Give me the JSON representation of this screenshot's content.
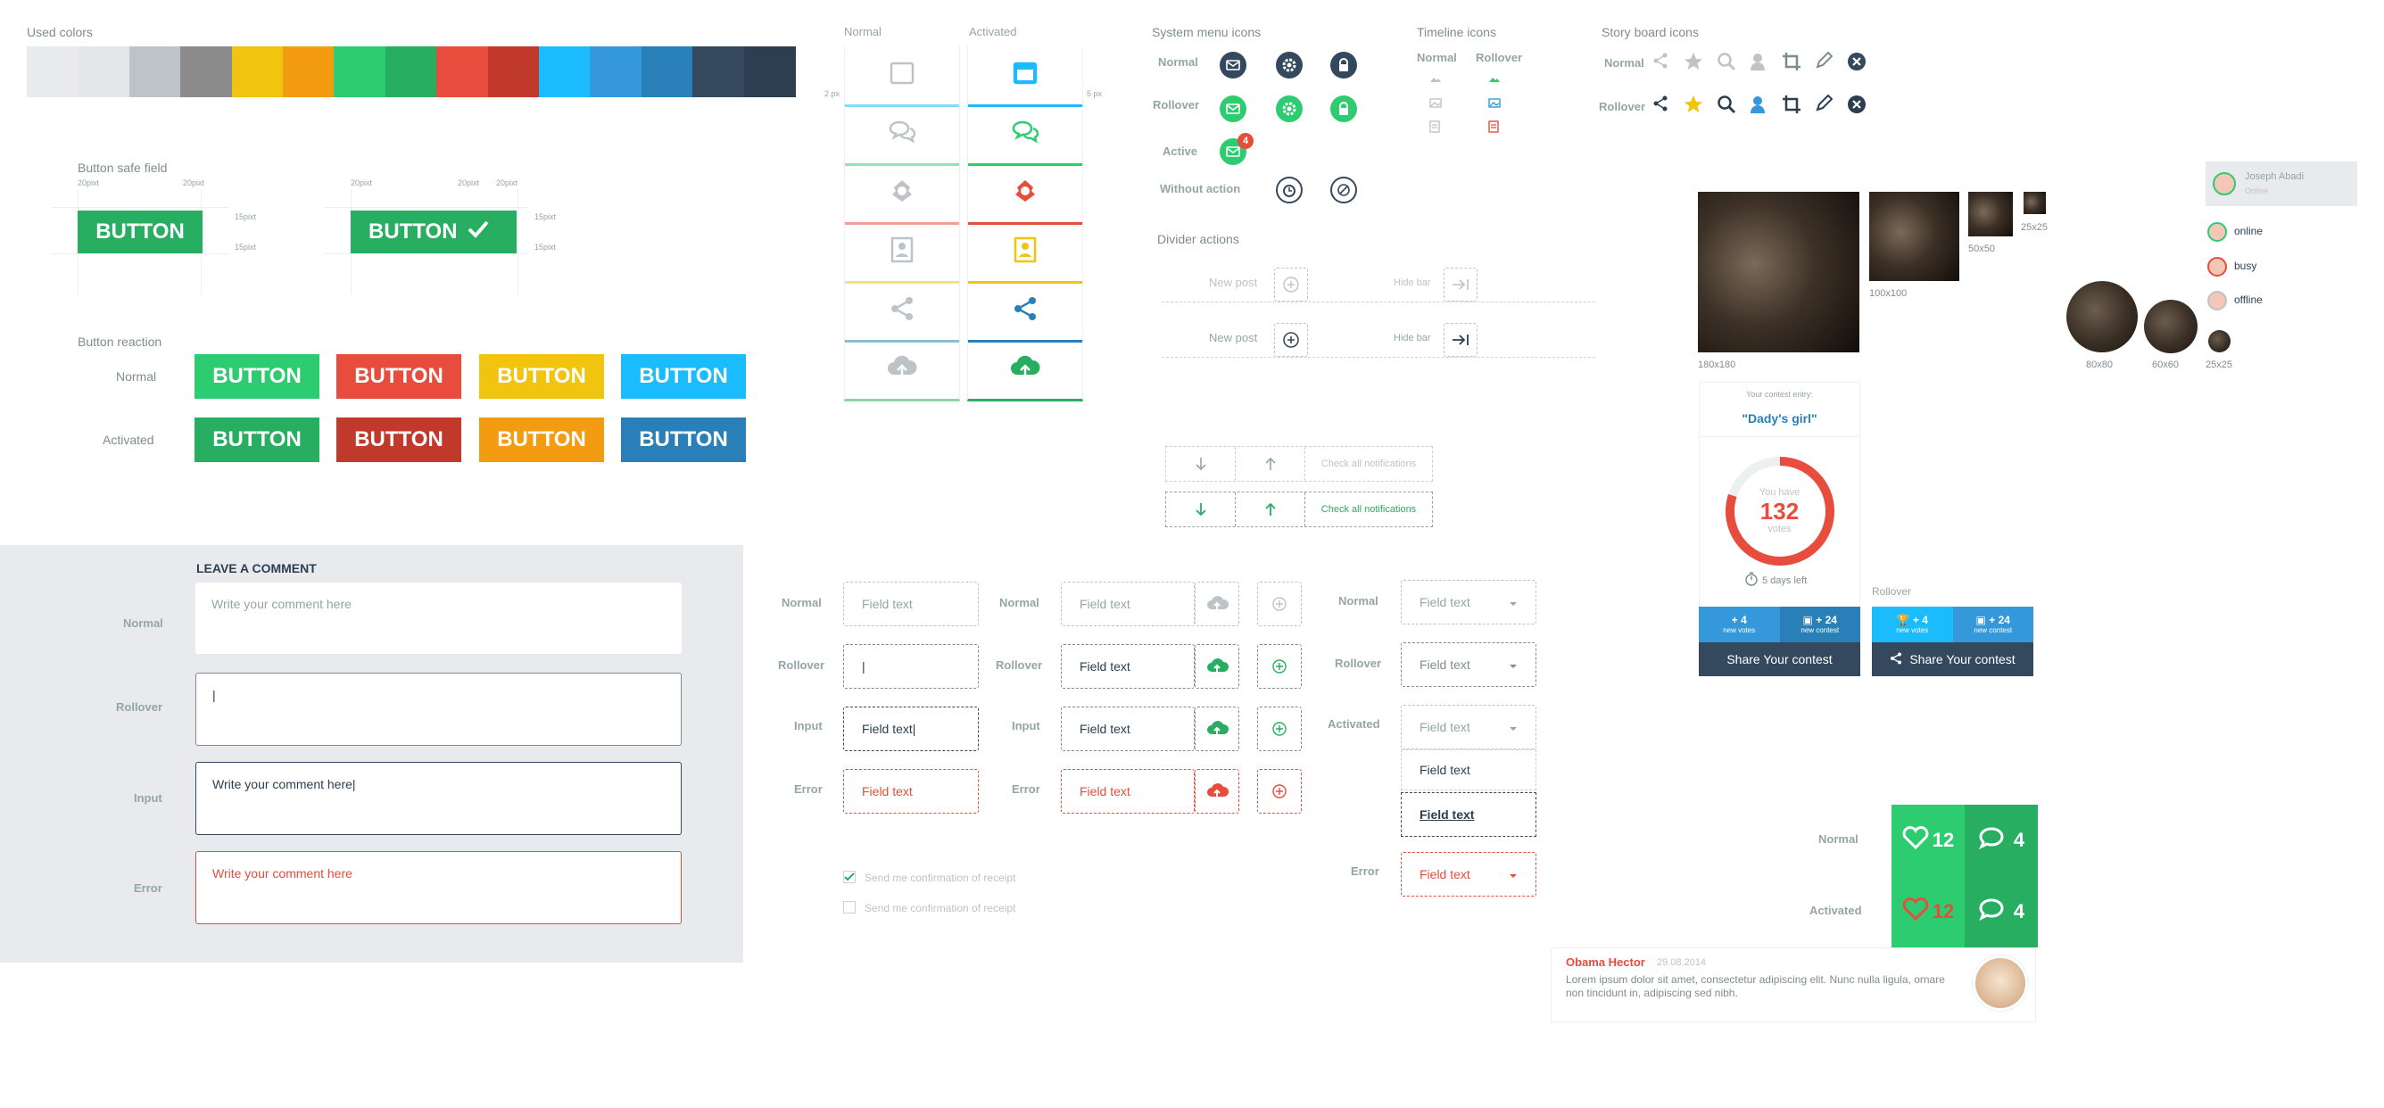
{
  "colors": {
    "title": "Used colors",
    "swatches": [
      "#e8eaec",
      "#e4e7ea",
      "#bdc3c7",
      "#8c8c8c",
      "#f1c40f",
      "#f39c12",
      "#2ecc71",
      "#27ae60",
      "#e74c3c",
      "#c0392b",
      "#1abcfe",
      "#3498db",
      "#2980b9",
      "#34495e",
      "#2c3e50"
    ]
  },
  "safe_field": {
    "title": "Button safe field",
    "btn": "BUTTON",
    "p20": "20pixt",
    "p15": "15pixt"
  },
  "reaction": {
    "title": "Button reaction",
    "normal": "Normal",
    "activated": "Activated",
    "btn": "BUTTON",
    "normal_colors": [
      "#2ecc71",
      "#e74c3c",
      "#f1c40f",
      "#1abcfe"
    ],
    "active_colors": [
      "#27ae60",
      "#c0392b",
      "#f39c12",
      "#2980b9"
    ]
  },
  "comment": {
    "title": "LEAVE A COMMENT",
    "normal": "Normal",
    "rollover": "Rollover",
    "input": "Input",
    "error": "Error",
    "placeholder": "Write your comment here",
    "cursor": "|",
    "typed": "Write your comment here|",
    "error_text": "Write your comment here"
  },
  "cards": {
    "normal": "Normal",
    "activated": "Activated",
    "px_left": "2 px",
    "px_right": "5 px",
    "icons": [
      "window-icon",
      "chat-icon",
      "user-badge-icon",
      "contact-card-icon",
      "share-icon",
      "cloud-upload-icon"
    ],
    "colors": [
      "#1abcfe",
      "#2ecc71",
      "#e74c3c",
      "#f1c40f",
      "#2980b9",
      "#27ae60"
    ]
  },
  "sysmenu": {
    "title": "System menu icons",
    "normal": "Normal",
    "rollover": "Rollover",
    "active": "Active",
    "without": "Without action",
    "badge": "4"
  },
  "timeline": {
    "title": "Timeline icons",
    "normal": "Normal",
    "rollover": "Rollover"
  },
  "storyboard": {
    "title": "Story board icons",
    "normal": "Normal",
    "rollover": "Rollover"
  },
  "divider": {
    "title": "Divider actions",
    "new_post": "New post",
    "hide_bar": "Hide bar"
  },
  "notifications": {
    "label": "Check all notifications"
  },
  "fields": {
    "normal": "Normal",
    "rollover": "Rollover",
    "input": "Input",
    "error": "Error",
    "activated": "Activated",
    "placeholder": "Field text",
    "cursor": "|",
    "typed": "Field text|",
    "value": "Field text",
    "error_text": "Field text",
    "opt1": "Field text",
    "opt2": "Field text",
    "confirm": "Send me confirmation of receipt"
  },
  "avatars": {
    "s180": "180x180",
    "s100": "100x100",
    "s50": "50x50",
    "s25": "25x25",
    "c80": "80x80",
    "c60": "60x60",
    "c25": "25x25"
  },
  "user": {
    "name": "Joseph Abadi",
    "status": "Online",
    "online": "online",
    "busy": "busy",
    "offline": "offline"
  },
  "contest": {
    "entry_label": "Your contest entry:",
    "entry_name": "\"Dady's girl\"",
    "you_have": "You have",
    "votes": "132",
    "votes_word": "votes",
    "days_left": "5 days left",
    "rollover": "Rollover",
    "plus_votes": "+ 4",
    "new_votes": "new votes",
    "plus_contest": "+ 24",
    "new_contest": "new contest",
    "share": "Share Your contest",
    "progress": 0.8
  },
  "likes": {
    "normal": "Normal",
    "activated": "Activated",
    "hearts": "12",
    "comments": "4"
  },
  "post": {
    "author": "Obama Hector",
    "date": "29.08.2014",
    "text": "Lorem ipsum dolor sit amet, consectetur adipiscing elit. Nunc nulla ligula, ornare non tincidunt in, adipiscing sed nibh."
  }
}
